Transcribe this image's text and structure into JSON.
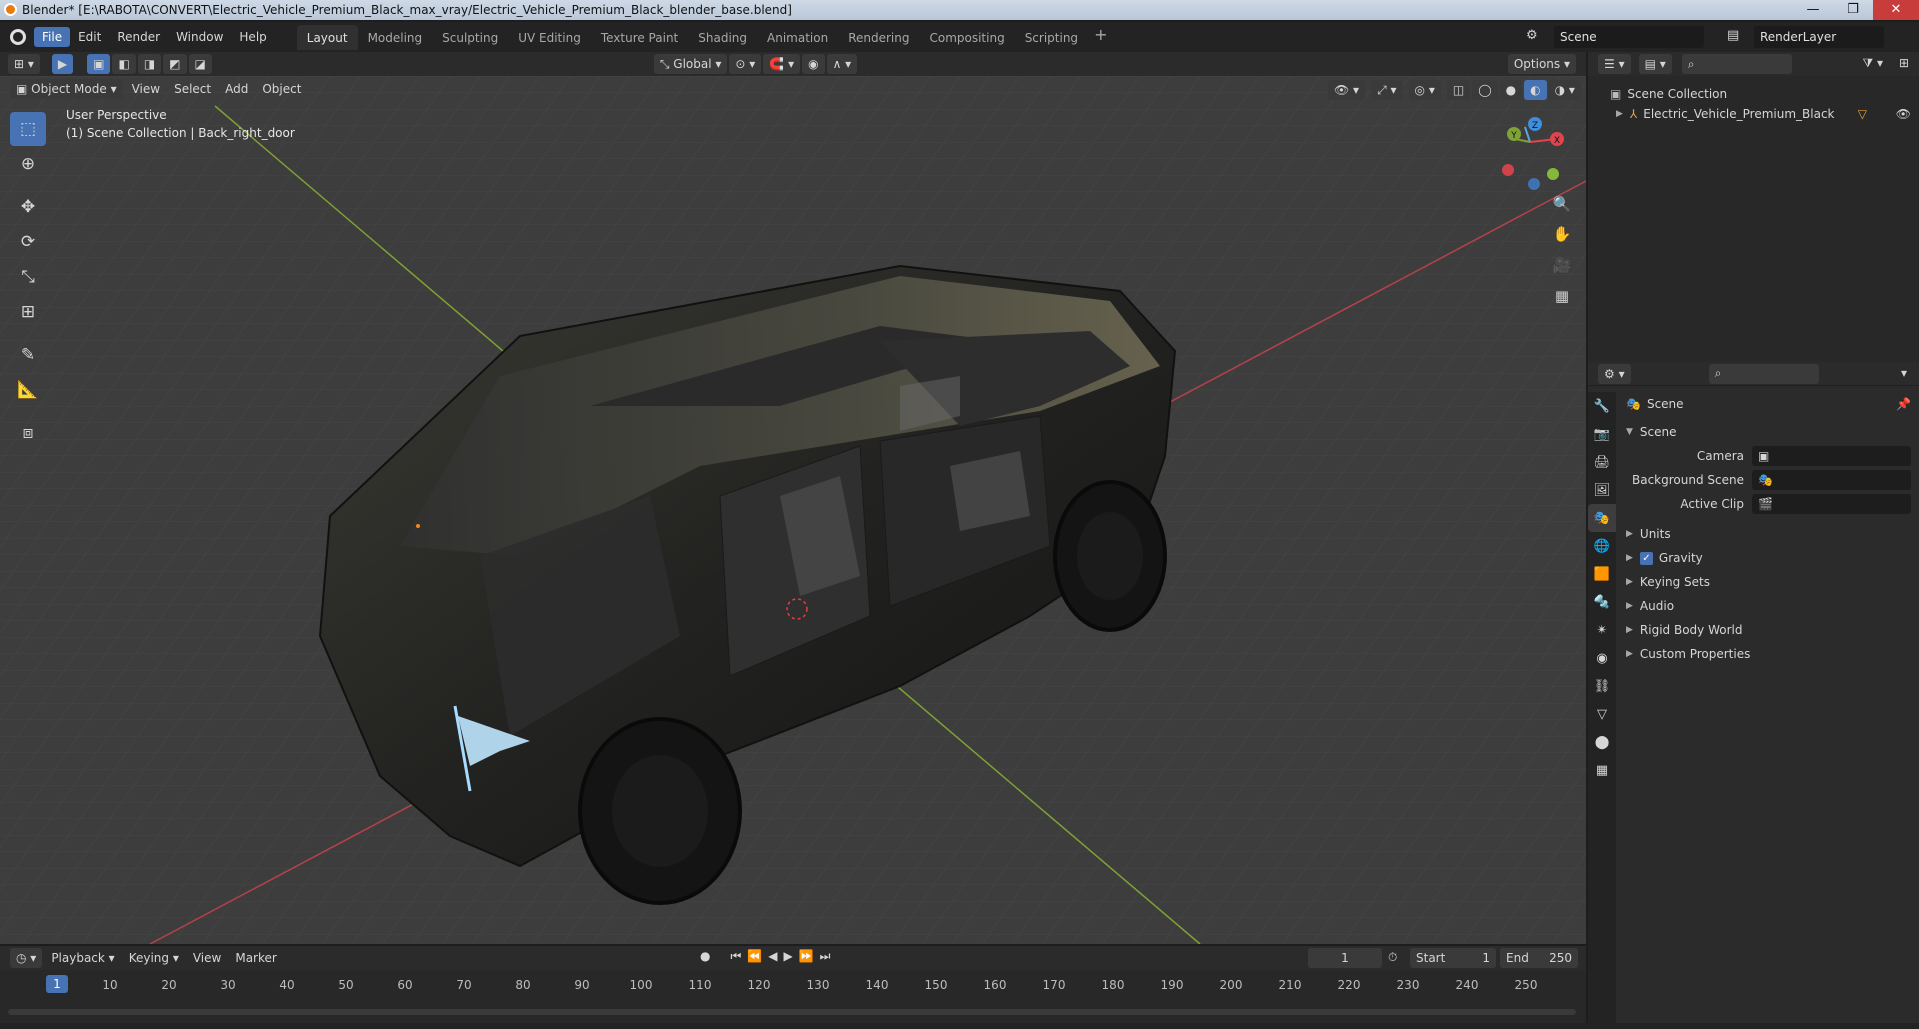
{
  "window": {
    "title": "Blender* [E:\\RABOTA\\CONVERT\\Electric_Vehicle_Premium_Black_max_vray/Electric_Vehicle_Premium_Black_blender_base.blend]",
    "minimize": "—",
    "maximize": "❐",
    "close": "✕"
  },
  "menubar": {
    "items": [
      "File",
      "Edit",
      "Render",
      "Window",
      "Help"
    ],
    "workspaces": [
      "Layout",
      "Modeling",
      "Sculpting",
      "UV Editing",
      "Texture Paint",
      "Shading",
      "Animation",
      "Rendering",
      "Compositing",
      "Scripting"
    ],
    "add_workspace": "+",
    "scene_name": "Scene",
    "view_layer": "RenderLayer"
  },
  "viewport_header": {
    "mode": "Object Mode",
    "menus": [
      "View",
      "Select",
      "Add",
      "Object"
    ],
    "transform_orientation": "Global",
    "options": "Options"
  },
  "viewport": {
    "perspective": "User Perspective",
    "collection_info": "(1) Scene Collection | Back_right_door",
    "gizmo": {
      "x": "X",
      "y": "Y",
      "z": "Z"
    }
  },
  "toolbar": {
    "tools": [
      "select-box",
      "cursor",
      "move",
      "rotate",
      "scale",
      "transform",
      "annotate",
      "measure",
      "add-cube"
    ]
  },
  "outliner": {
    "root": "Scene Collection",
    "items": [
      {
        "label": "Electric_Vehicle_Premium_Black"
      }
    ]
  },
  "properties": {
    "header": "Scene",
    "section": "Scene",
    "fields": [
      {
        "label": "Camera",
        "value": ""
      },
      {
        "label": "Background Scene",
        "value": ""
      },
      {
        "label": "Active Clip",
        "value": ""
      }
    ],
    "panels": [
      "Units",
      "Gravity",
      "Keying Sets",
      "Audio",
      "Rigid Body World",
      "Custom Properties"
    ],
    "gravity_enabled": true
  },
  "timeline": {
    "menus": [
      "Playback",
      "Keying",
      "View",
      "Marker"
    ],
    "current_frame": "1",
    "start_label": "Start",
    "start": "1",
    "end_label": "End",
    "end": "250",
    "ticks": [
      "1",
      "10",
      "20",
      "30",
      "40",
      "50",
      "60",
      "70",
      "80",
      "90",
      "100",
      "110",
      "120",
      "130",
      "140",
      "150",
      "160",
      "170",
      "180",
      "190",
      "200",
      "210",
      "220",
      "230",
      "240",
      "250"
    ]
  },
  "colors": {
    "accent": "#4772b3",
    "viewport_bg": "#3d3d3d",
    "axis_x": "#b4424a",
    "axis_y": "#7ea234"
  }
}
